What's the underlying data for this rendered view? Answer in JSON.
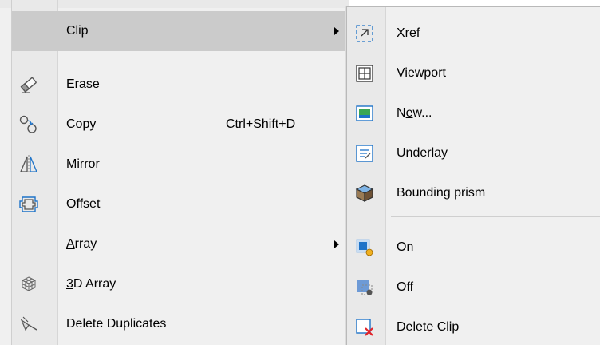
{
  "main_menu": {
    "items": [
      {
        "label": "Clip",
        "icon": "none",
        "has_submenu": true,
        "highlighted": true
      },
      {
        "label": "Erase",
        "icon": "eraser-icon"
      },
      {
        "label_pre": "Cop",
        "label_ul": "y",
        "label_post": "",
        "accelerator": "Ctrl+Shift+D",
        "icon": "copy-icon"
      },
      {
        "label": "Mirror",
        "icon": "mirror-icon"
      },
      {
        "label": "Offset",
        "icon": "offset-icon"
      },
      {
        "label_pre": "",
        "label_ul": "A",
        "label_post": "rray",
        "icon": "none",
        "has_submenu": true
      },
      {
        "label_pre": "",
        "label_ul": "3",
        "label_post": "D Array",
        "icon": "3d-array-icon"
      },
      {
        "label": "Delete Duplicates",
        "icon": "delete-duplicates-icon"
      }
    ]
  },
  "clip_submenu": {
    "items": [
      {
        "label": "Xref",
        "icon": "xref-clip-icon"
      },
      {
        "label": "Viewport",
        "icon": "viewport-clip-icon"
      },
      {
        "label_pre": "N",
        "label_ul": "e",
        "label_post": "w...",
        "icon": "new-clip-icon"
      },
      {
        "label": "Underlay",
        "icon": "underlay-clip-icon"
      },
      {
        "label": "Bounding prism",
        "icon": "bounding-prism-icon"
      },
      {
        "label": "On",
        "icon": "clip-on-icon"
      },
      {
        "label": "Off",
        "icon": "clip-off-icon"
      },
      {
        "label": "Delete Clip",
        "icon": "delete-clip-icon"
      }
    ]
  },
  "colors": {
    "menu_bg": "#f0f0f0",
    "gutter_bg": "#e9e9e9",
    "highlight_bg": "#cbcbcb",
    "icon_blue": "#1e73c8",
    "delete_red": "#e0242a"
  }
}
